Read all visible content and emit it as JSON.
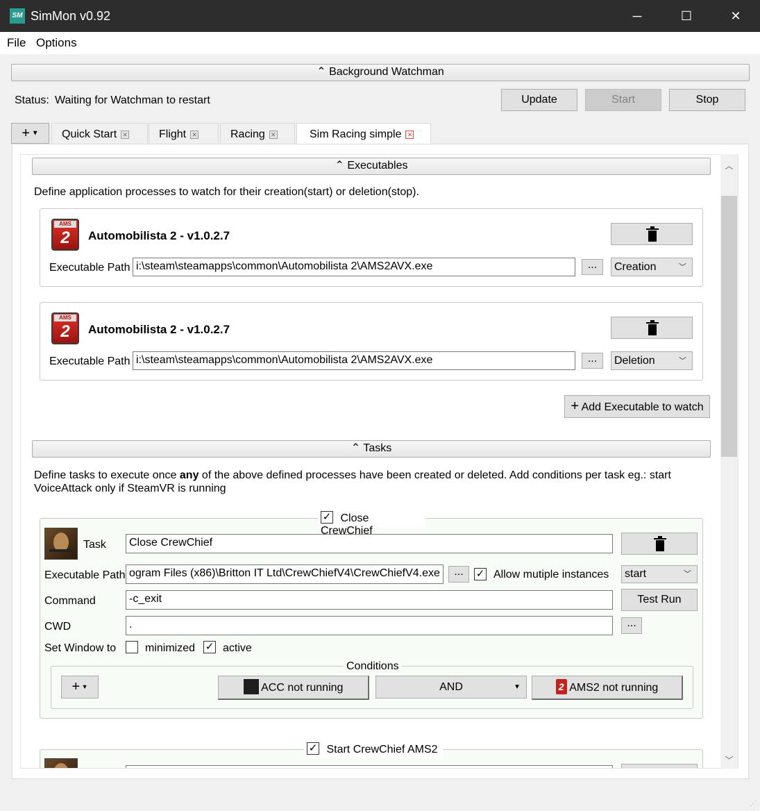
{
  "window": {
    "title": "SimMon v0.92",
    "minimize": "─",
    "maximize": "☐",
    "close": "✕",
    "app_icon_text": "SM"
  },
  "menu": {
    "file": "File",
    "options": "Options"
  },
  "watchman": {
    "header": "Background Watchman",
    "status_label": "Status:",
    "status_value": "Waiting for Watchman to restart",
    "update": "Update",
    "start": "Start",
    "stop": "Stop"
  },
  "tabs": {
    "add": "+",
    "items": [
      {
        "label": "Quick Start"
      },
      {
        "label": "Flight"
      },
      {
        "label": "Racing"
      },
      {
        "label": "Sim Racing simple"
      }
    ],
    "active": "Sim Racing simple"
  },
  "executables": {
    "header": "Executables",
    "description": "Define application processes to watch for their creation(start) or deletion(stop).",
    "path_label": "Executable Path",
    "browse": "...",
    "items": [
      {
        "name": "Automobilista 2 - v1.0.2.7",
        "path": "i:\\steam\\steamapps\\common\\Automobilista 2\\AMS2AVX.exe",
        "event": "Creation",
        "icon": "ams2-icon"
      },
      {
        "name": "Automobilista 2 - v1.0.2.7",
        "path": "i:\\steam\\steamapps\\common\\Automobilista 2\\AMS2AVX.exe",
        "event": "Deletion",
        "icon": "ams2-icon"
      }
    ],
    "add_button": "Add Executable to watch"
  },
  "tasks": {
    "header": "Tasks",
    "description_pre": "Define tasks to execute once ",
    "description_bold": "any",
    "description_post": " of the above defined processes have been created or deleted. Add conditions per task eg.: start VoiceAttack only if SteamVR is running",
    "items": [
      {
        "title": "Close CrewChief",
        "enabled": true,
        "task_label": "Task",
        "task_value": "Close CrewChief",
        "path_label": "Executable Path",
        "path_value": "ogram Files (x86)\\Britton IT Ltd\\CrewChiefV4\\CrewChiefV4.exe",
        "browse": "...",
        "allow_multiple_label": "Allow mutiple instances",
        "allow_multiple": true,
        "mode": "start",
        "command_label": "Command",
        "command_value": "-c_exit",
        "test_run": "Test Run",
        "cwd_label": "CWD",
        "cwd_value": ".",
        "window_label": "Set Window to",
        "minimized_label": "minimized",
        "minimized": false,
        "active_label": "active",
        "active": true,
        "conditions": {
          "header": "Conditions",
          "add": "+",
          "left": "ACC not running",
          "operator": "AND",
          "right": "AMS2 not running"
        }
      },
      {
        "title": "Start CrewChief AMS2",
        "enabled": true
      }
    ]
  }
}
